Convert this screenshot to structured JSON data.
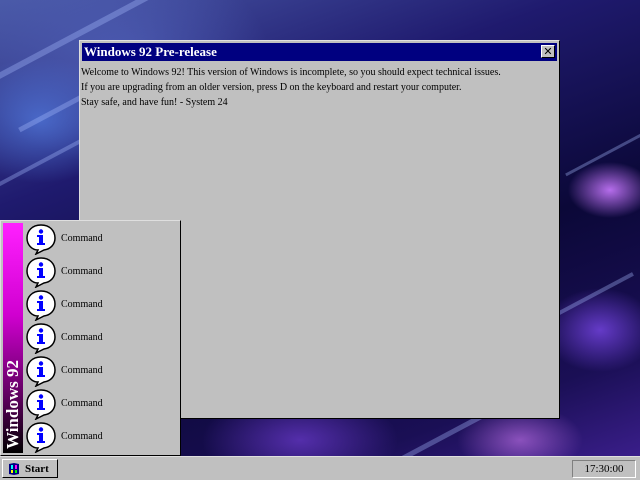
{
  "window": {
    "title": "Windows 92 Pre-release",
    "close_glyph": "✕",
    "lines": [
      "Welcome to Windows 92! This version of Windows is incomplete, so you should expect technical issues.",
      "If you are upgrading from an older version, press D on the keyboard and restart your computer.",
      "Stay safe, and have fun! - System 24"
    ]
  },
  "start_menu": {
    "banner": "Windows 92",
    "items": [
      {
        "label": "Command",
        "icon": "info-icon"
      },
      {
        "label": "Command",
        "icon": "info-icon"
      },
      {
        "label": "Command",
        "icon": "info-icon"
      },
      {
        "label": "Command",
        "icon": "info-icon"
      },
      {
        "label": "Command",
        "icon": "info-icon"
      },
      {
        "label": "Command",
        "icon": "info-icon"
      },
      {
        "label": "Command",
        "icon": "info-icon"
      }
    ]
  },
  "taskbar": {
    "start_label": "Start",
    "start_icon": "windows-logo-icon",
    "clock": "17:30:00"
  },
  "colors": {
    "titlebar": "#000080",
    "face": "#c0c0c0",
    "banner_top": "#ff20ff",
    "banner_bottom": "#000000"
  }
}
